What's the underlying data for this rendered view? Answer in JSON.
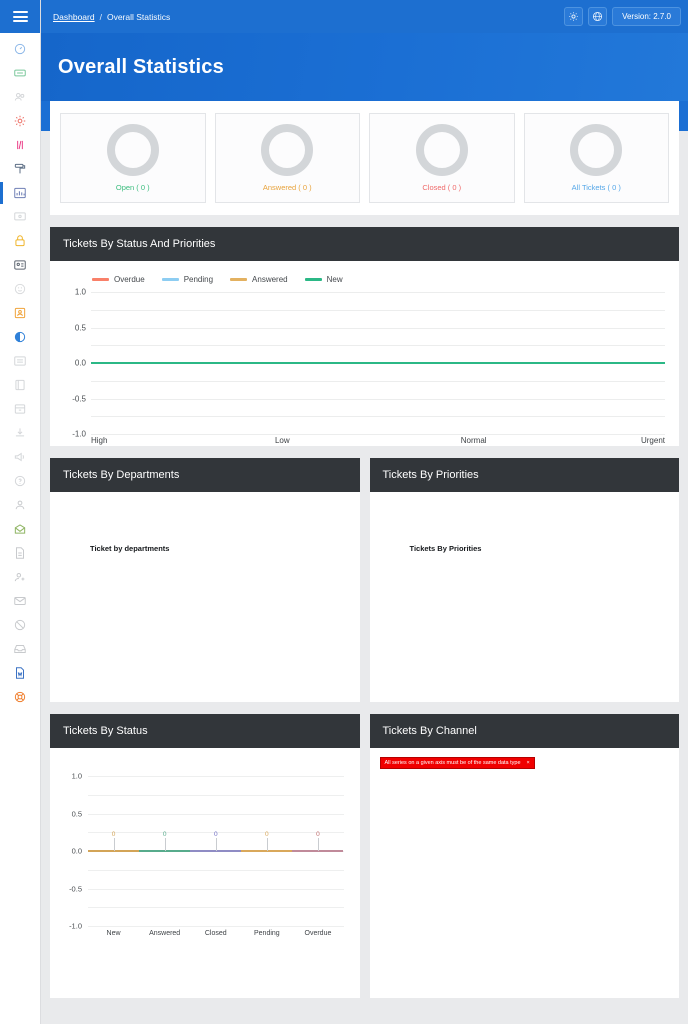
{
  "topbar": {
    "breadcrumb_link": "Dashboard",
    "breadcrumb_sep": "/",
    "breadcrumb_current": "Overall Statistics",
    "gear_icon": "gear-icon",
    "globe_icon": "globe-icon",
    "version_label": "Version: 2.7.0"
  },
  "header": {
    "title": "Overall Statistics"
  },
  "sidebar": {
    "menu_icon": "hamburger-icon",
    "items": [
      {
        "name": "dashboard",
        "icon": "speedometer-icon",
        "color": "#8cb7e8",
        "active": false
      },
      {
        "name": "tickets",
        "icon": "ticket-icon",
        "color": "#79c79a",
        "active": false
      },
      {
        "name": "users",
        "icon": "users-icon",
        "color": "#d4d6d9",
        "active": false
      },
      {
        "name": "settings",
        "icon": "gear-icon",
        "color": "#ec6a60",
        "active": false
      },
      {
        "name": "code",
        "icon": "code-brackets-icon",
        "color": "#ea3d87",
        "active": false
      },
      {
        "name": "appearance",
        "icon": "paint-roller-icon",
        "color": "#5b6d84",
        "active": false
      },
      {
        "name": "statistics",
        "icon": "bar-chart-icon",
        "color": "#6f7fb5",
        "active": true
      },
      {
        "name": "screen",
        "icon": "monitor-icon",
        "color": "#d4d6d9",
        "active": false
      },
      {
        "name": "security",
        "icon": "lock-icon",
        "color": "#f0b429",
        "active": false
      },
      {
        "name": "id-card",
        "icon": "id-card-icon",
        "color": "#5d6570",
        "active": false
      },
      {
        "name": "emoji",
        "icon": "smiley-icon",
        "color": "#d9dbdd",
        "active": false
      },
      {
        "name": "staff",
        "icon": "badge-person-icon",
        "color": "#f0a33a",
        "active": false
      },
      {
        "name": "brightness",
        "icon": "contrast-circle-icon",
        "color": "#2f80d8",
        "active": false
      },
      {
        "name": "list",
        "icon": "list-icon",
        "color": "#d4d6d9",
        "active": false
      },
      {
        "name": "book",
        "icon": "book-icon",
        "color": "#d4d6d9",
        "active": false
      },
      {
        "name": "archive",
        "icon": "archive-box-icon",
        "color": "#d4d6d9",
        "active": false
      },
      {
        "name": "import",
        "icon": "import-icon",
        "color": "#d4d6d9",
        "active": false
      },
      {
        "name": "announcement",
        "icon": "megaphone-icon",
        "color": "#d4d6d9",
        "active": false
      },
      {
        "name": "help",
        "icon": "question-badge-icon",
        "color": "#d4d6d9",
        "active": false
      },
      {
        "name": "profile",
        "icon": "person-icon",
        "color": "#c8cacd",
        "active": false
      },
      {
        "name": "mail-open",
        "icon": "open-envelope-icon",
        "color": "#8fb563",
        "active": false
      },
      {
        "name": "document",
        "icon": "document-icon",
        "color": "#c8cacd",
        "active": false
      },
      {
        "name": "add-user",
        "icon": "person-add-icon",
        "color": "#c8cacd",
        "active": false
      },
      {
        "name": "inbox",
        "icon": "envelope-icon",
        "color": "#c8cacd",
        "active": false
      },
      {
        "name": "ban",
        "icon": "ban-icon",
        "color": "#c8cacd",
        "active": false
      },
      {
        "name": "inbox-tray",
        "icon": "inbox-tray-icon",
        "color": "#c8cacd",
        "active": false
      },
      {
        "name": "word-doc",
        "icon": "word-file-icon",
        "color": "#3b72c4",
        "active": false
      },
      {
        "name": "support",
        "icon": "lifebuoy-icon",
        "color": "#f07f2e",
        "active": false
      }
    ]
  },
  "stats": {
    "cards": [
      {
        "label": "Open ( 0 )",
        "color": "#3bbd7e",
        "ring": "#d3d6d9"
      },
      {
        "label": "Answered ( 0 )",
        "color": "#e8a33c",
        "ring": "#d3d6d9"
      },
      {
        "label": "Closed ( 0 )",
        "color": "#ef6b6b",
        "ring": "#d3d6d9"
      },
      {
        "label": "All Tickets ( 0 )",
        "color": "#55a7e8",
        "ring": "#d3d6d9"
      }
    ]
  },
  "panels": {
    "status_priorities": {
      "title": "Tickets By Status And Priorities"
    },
    "departments": {
      "title": "Tickets By Departments",
      "caption": "Ticket by departments"
    },
    "priorities": {
      "title": "Tickets By Priorities",
      "caption": "Tickets By Priorities"
    },
    "status": {
      "title": "Tickets By Status"
    },
    "channel": {
      "title": "Tickets By Channel",
      "error": "All series on a given axis must be of the same data type",
      "error_close": "×"
    }
  },
  "chart_data": [
    {
      "id": "tickets-by-status-and-priorities",
      "type": "line",
      "title": "Tickets By Status And Priorities",
      "categories": [
        "High",
        "Low",
        "Normal",
        "Urgent"
      ],
      "series": [
        {
          "name": "Overdue",
          "values": [
            0,
            0,
            0,
            0
          ],
          "color": "#f98069"
        },
        {
          "name": "Pending",
          "values": [
            0,
            0,
            0,
            0
          ],
          "color": "#8dcdf2"
        },
        {
          "name": "Answered",
          "values": [
            0,
            0,
            0,
            0
          ],
          "color": "#e3b160"
        },
        {
          "name": "New",
          "values": [
            0,
            0,
            0,
            0
          ],
          "color": "#2bb886"
        }
      ],
      "ylim": [
        -1.0,
        1.0
      ],
      "yticks": [
        "1.0",
        "0.5",
        "0.0",
        "-0.5",
        "-1.0"
      ],
      "ytick_values": [
        1.0,
        0.5,
        0.0,
        -0.5,
        -1.0
      ],
      "gridlines": [
        1.0,
        0.75,
        0.5,
        0.25,
        0.0,
        -0.25,
        -0.5,
        -0.75,
        -1.0
      ],
      "grid": true,
      "legend": "top-left",
      "xlabel": "",
      "ylabel": ""
    },
    {
      "id": "tickets-by-departments",
      "type": "pie",
      "title": "Ticket by departments",
      "categories": [],
      "values": [],
      "empty": true
    },
    {
      "id": "tickets-by-priorities",
      "type": "pie",
      "title": "Tickets By Priorities",
      "categories": [],
      "values": [],
      "empty": true
    },
    {
      "id": "tickets-by-status",
      "type": "bar",
      "title": "Tickets By Status",
      "categories": [
        "New",
        "Answered",
        "Closed",
        "Pending",
        "Overdue"
      ],
      "values": [
        0,
        0,
        0,
        0,
        0
      ],
      "point_labels": [
        "0",
        "0",
        "0",
        "0",
        "0"
      ],
      "colors": [
        "#d3a457",
        "#57ab8c",
        "#8f8cc4",
        "#d9a85b",
        "#c08a9a"
      ],
      "label_colors": [
        "#d3a457",
        "#57ab8c",
        "#6f6cc4",
        "#d9a85b",
        "#c06b6b"
      ],
      "ylim": [
        -1.0,
        1.0
      ],
      "yticks": [
        "1.0",
        "0.5",
        "0.0",
        "-0.5",
        "-1.0"
      ],
      "ytick_values": [
        1.0,
        0.5,
        0.0,
        -0.5,
        -1.0
      ],
      "gridlines": [
        1.0,
        0.75,
        0.5,
        0.25,
        0.0,
        -0.25,
        -0.5,
        -0.75,
        -1.0
      ],
      "grid": true,
      "xlabel": "",
      "ylabel": ""
    },
    {
      "id": "tickets-by-channel",
      "type": "bar",
      "title": "Tickets By Channel",
      "error": "All series on a given axis must be of the same data type",
      "categories": [],
      "values": [],
      "empty": true
    }
  ]
}
